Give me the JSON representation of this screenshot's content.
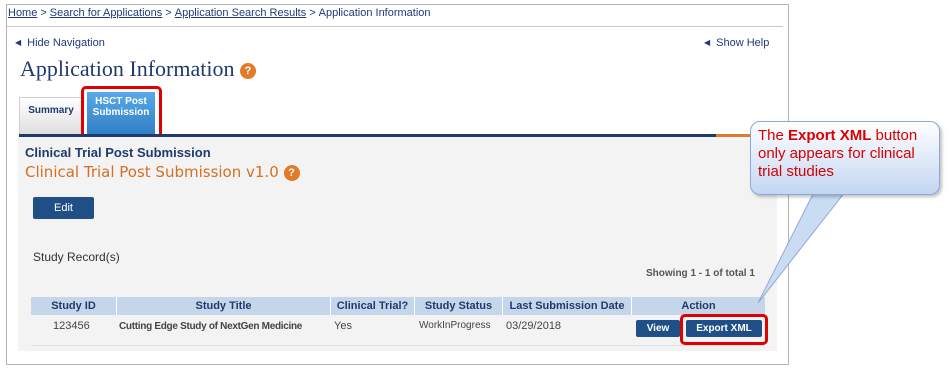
{
  "breadcrumb": {
    "home": "Home",
    "search": "Search for Applications",
    "results": "Application Search Results",
    "current": "Application Information",
    "separator": ">"
  },
  "nav": {
    "hide_label": "Hide Navigation",
    "show_help_label": "Show Help"
  },
  "page": {
    "title": "Application Information"
  },
  "tabs": [
    {
      "label": "Summary"
    },
    {
      "label_line1": "HSCT Post",
      "label_line2": "Submission"
    }
  ],
  "section": {
    "title": "Clinical Trial Post Submission",
    "form_title": "Clinical Trial Post Submission v1.0",
    "edit_button": "Edit",
    "study_records_label": "Study Record(s)",
    "showing": "Showing 1 - 1 of total 1"
  },
  "table": {
    "headers": [
      "Study ID",
      "Study Title",
      "Clinical Trial?",
      "Study Status",
      "Last Submission Date",
      "Action"
    ],
    "rows": [
      {
        "id": "123456",
        "title": "Cutting Edge Study of NextGen Medicine",
        "clinical": "Yes",
        "status": "WorkInProgress",
        "date": "03/29/2018",
        "view": "View",
        "export": "Export XML"
      }
    ]
  },
  "callout": {
    "prefix": "The ",
    "bold": "Export XML",
    "suffix": " button only appears for clinical trial studies"
  },
  "colors": {
    "brand_navy": "#1f3a6e",
    "accent_orange": "#e07b28",
    "highlight_red": "#e00000",
    "button_blue": "#1f4f86"
  },
  "icons": {
    "help": "question-circle-icon",
    "nav_arrow": "left-triangle-icon"
  }
}
